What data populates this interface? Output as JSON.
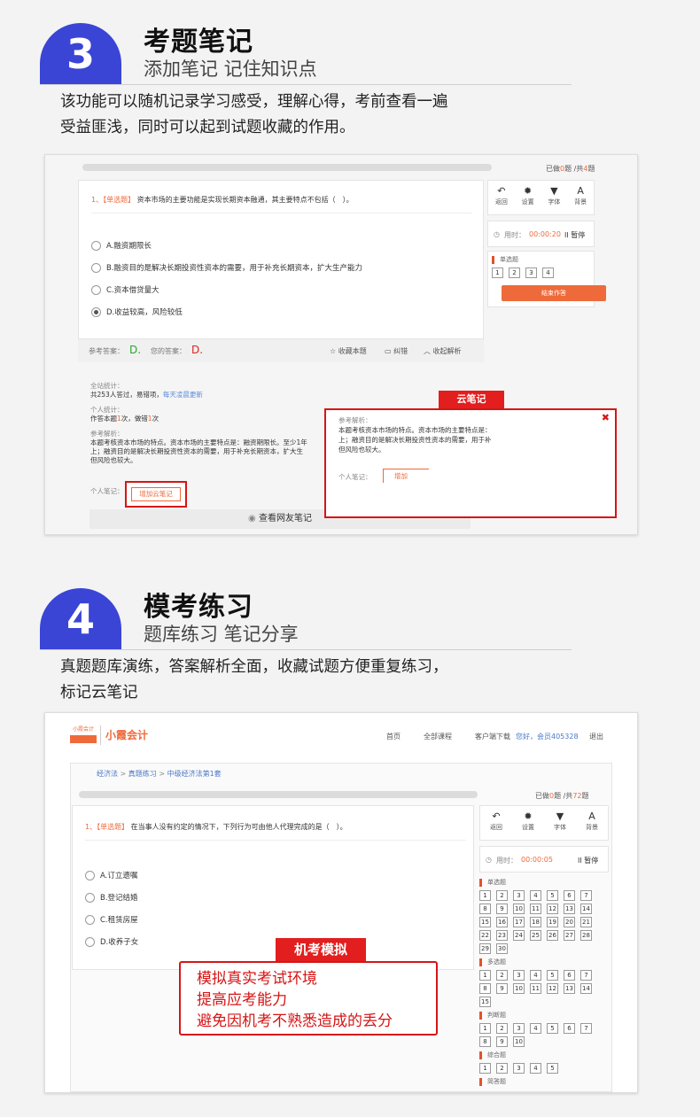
{
  "section3": {
    "number": "3",
    "title": "考题笔记",
    "subtitle": "添加笔记 记住知识点",
    "desc_lines": [
      "该功能可以随机记录学习感受，理解心得，考前查看一遍",
      "受益匪浅，同时可以起到试题收藏的作用。"
    ],
    "progress_text_pre": "已做",
    "progress_done": "0",
    "progress_mid": "题 /共",
    "progress_total": "4",
    "progress_post": "题",
    "question_num": "1、",
    "question_type": "【单选题】",
    "question_text": "资本市场的主要功能是实现长期资本融通，其主要特点不包括（　）。",
    "options": [
      "A.融资期限长",
      "B.融资目的是解决长期投资性资本的需要，用于补充长期资本，扩大生产能力",
      "C.资本借贷量大",
      "D.收益较高，风险较低"
    ],
    "selected_option": 3,
    "ref_answer_label": "参考答案：",
    "ref_answer": "D.",
    "your_answer_label": "您的答案：",
    "your_answer": "D.",
    "action_favorite": "收藏本题",
    "action_correct": "纠错",
    "action_collapse": "收起解析",
    "tools": [
      {
        "icon": "返回-icon",
        "glyph": "↶",
        "label": "返回"
      },
      {
        "icon": "gear-icon",
        "glyph": "✹",
        "label": "设置"
      },
      {
        "icon": "shirt-icon",
        "glyph": "▼",
        "label": "字体"
      },
      {
        "icon": "font-size-icon",
        "glyph": "A",
        "label": "背景"
      }
    ],
    "timer_label": "用时：",
    "timer_value": "00:00:20",
    "pause_label": "暂停",
    "group_label": "单选题",
    "numbers": [
      "1",
      "2",
      "3",
      "4"
    ],
    "finish_label": "结束作答",
    "stats_title": "全站统计：",
    "stats_text": "共253人答过，易错项，",
    "stats_update": "每天凌晨更新",
    "personal_title": "个人统计：",
    "personal_pre": "作答本题",
    "personal_count": "1",
    "personal_mid": "次，做错",
    "personal_wrong": "1",
    "personal_post": "次",
    "analysis_title": "参考解析：",
    "analysis_lines": [
      "本题考核资本市场的特点。资本市场的主要特点是：融资期限长。至少1年",
      "上；融资目的是解决长期投资性资本的需要，用于补充长期资本，扩大生",
      "但风险也较大。"
    ],
    "note_label": "个人笔记：",
    "add_note_button": "增加云笔记",
    "view_notes": "查看网友笔记",
    "popup_tag": "云笔记",
    "popup_title": "参考解析：",
    "popup_lines": [
      "本题考核资本市场的特点。资本市场的主要特点是：",
      "上；融资目的是解决长期投资性资本的需要，用于补",
      "但风险也较大。"
    ],
    "popup_note_label": "个人笔记：",
    "popup_add": "增加"
  },
  "section4": {
    "number": "4",
    "title": "模考练习",
    "subtitle": "题库练习 笔记分享",
    "desc_lines": [
      "真题题库演练，答案解析全面，收藏试题方便重复练习，",
      "标记云笔记"
    ],
    "logo_small": "小霞会计",
    "logo_big": "小霞会计",
    "nav": [
      "首页",
      "全部课程",
      "客户端下载"
    ],
    "greeting": "您好，会员405328",
    "logout": "退出",
    "breadcrumb": [
      "经济法",
      "真题练习",
      "中级经济法第1套"
    ],
    "progress_text_pre": "已做",
    "progress_done": "0",
    "progress_mid": "题 /共",
    "progress_total": "72",
    "progress_post": "题",
    "question_num": "1、",
    "question_type": "【单选题】",
    "question_text": "在当事人没有约定的情况下，下列行为可由他人代理完成的是（　）。",
    "options": [
      "A.订立遗嘱",
      "B.登记结婚",
      "C.租赁房屋",
      "D.收养子女"
    ],
    "tools": [
      {
        "icon": "返回-icon",
        "glyph": "↶",
        "label": "返回"
      },
      {
        "icon": "gear-icon",
        "glyph": "✹",
        "label": "设置"
      },
      {
        "icon": "shirt-icon",
        "glyph": "▼",
        "label": "字体"
      },
      {
        "icon": "font-size-icon",
        "glyph": "A",
        "label": "背景"
      }
    ],
    "timer_label": "用时：",
    "timer_value": "00:00:05",
    "pause_label": "暂停",
    "groups": [
      {
        "label": "单选题",
        "numbers": [
          "1",
          "2",
          "3",
          "4",
          "5",
          "6",
          "7",
          "8",
          "9",
          "10",
          "11",
          "12",
          "13",
          "14",
          "15",
          "16",
          "17",
          "18",
          "19",
          "20",
          "21",
          "22",
          "23",
          "24",
          "25",
          "26",
          "27",
          "28",
          "29",
          "30"
        ]
      },
      {
        "label": "多选题",
        "numbers": [
          "1",
          "2",
          "3",
          "4",
          "5",
          "6",
          "7",
          "8",
          "9",
          "10",
          "11",
          "12",
          "13",
          "14",
          "15"
        ]
      },
      {
        "label": "判断题",
        "numbers": [
          "1",
          "2",
          "3",
          "4",
          "5",
          "6",
          "7",
          "8",
          "9",
          "10"
        ]
      },
      {
        "label": "综合题",
        "numbers": [
          "1",
          "2",
          "3",
          "4",
          "5"
        ]
      },
      {
        "label": "简答题",
        "numbers": []
      }
    ],
    "callout_tag": "机考模拟",
    "callout_lines": [
      "模拟真实考试环境",
      "提高应考能力",
      "避免因机考不熟悉造成的丢分"
    ]
  },
  "colors": {
    "accent_blue": "#3a45d6",
    "callout_red": "#e21e1e",
    "orange": "#ef6a3a"
  }
}
